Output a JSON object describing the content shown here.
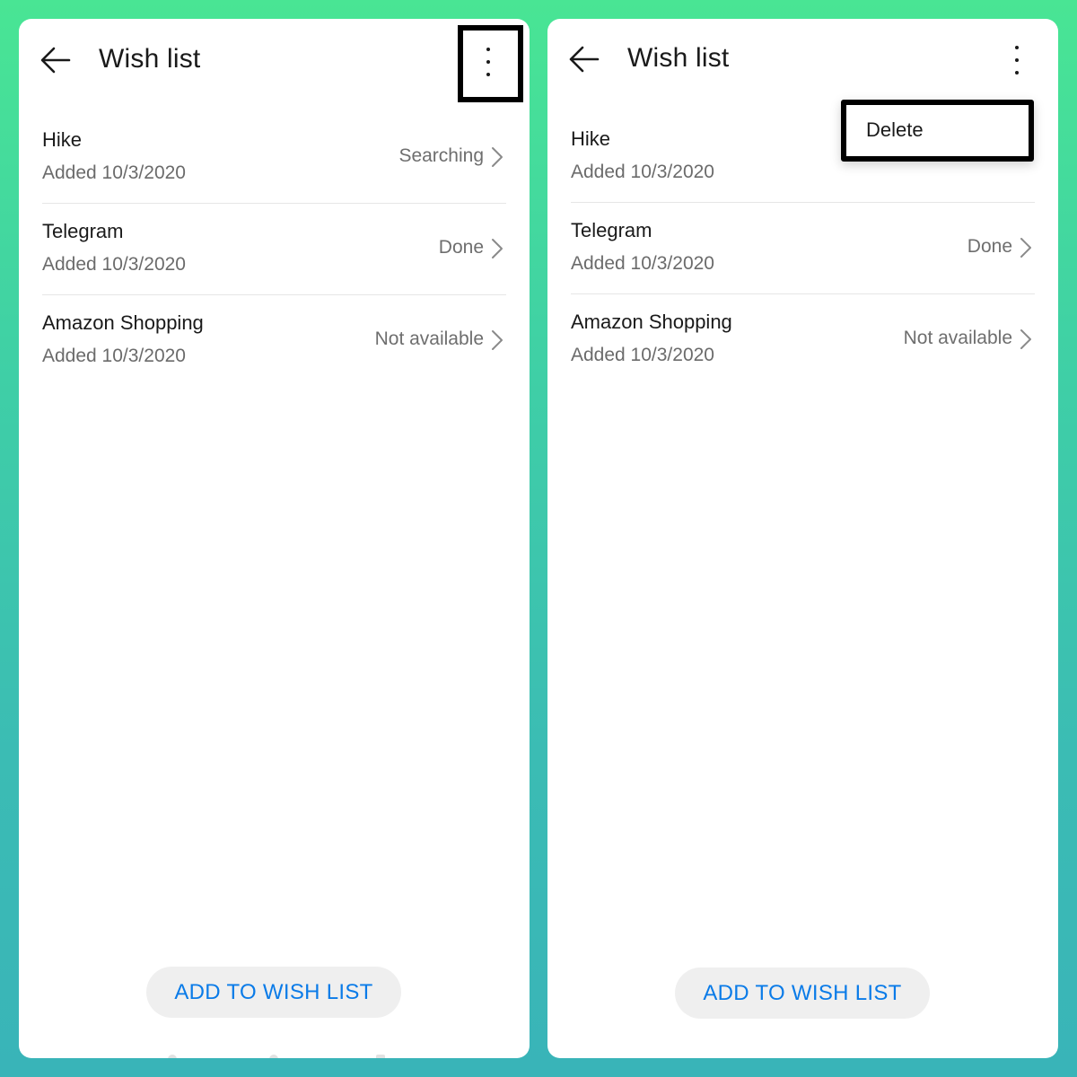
{
  "left_screen": {
    "title": "Wish list",
    "items": [
      {
        "name": "Hike",
        "added": "Added 10/3/2020",
        "status": "Searching"
      },
      {
        "name": "Telegram",
        "added": "Added 10/3/2020",
        "status": "Done"
      },
      {
        "name": "Amazon Shopping",
        "added": "Added 10/3/2020",
        "status": "Not available"
      }
    ],
    "add_button": "ADD TO WISH LIST"
  },
  "right_screen": {
    "title": "Wish list",
    "items": [
      {
        "name": "Hike",
        "added": "Added 10/3/2020",
        "status": ""
      },
      {
        "name": "Telegram",
        "added": "Added 10/3/2020",
        "status": "Done"
      },
      {
        "name": "Amazon Shopping",
        "added": "Added 10/3/2020",
        "status": "Not available"
      }
    ],
    "menu": {
      "delete_label": "Delete"
    },
    "add_button": "ADD TO WISH LIST"
  },
  "colors": {
    "accent_blue": "#0a7be8",
    "background_green": "#49e594",
    "background_teal": "#39b4b8",
    "highlight_border": "#000000"
  },
  "icons": {
    "back": "arrow-left-icon",
    "more": "more-vertical-icon",
    "chevron": "chevron-right-icon"
  }
}
